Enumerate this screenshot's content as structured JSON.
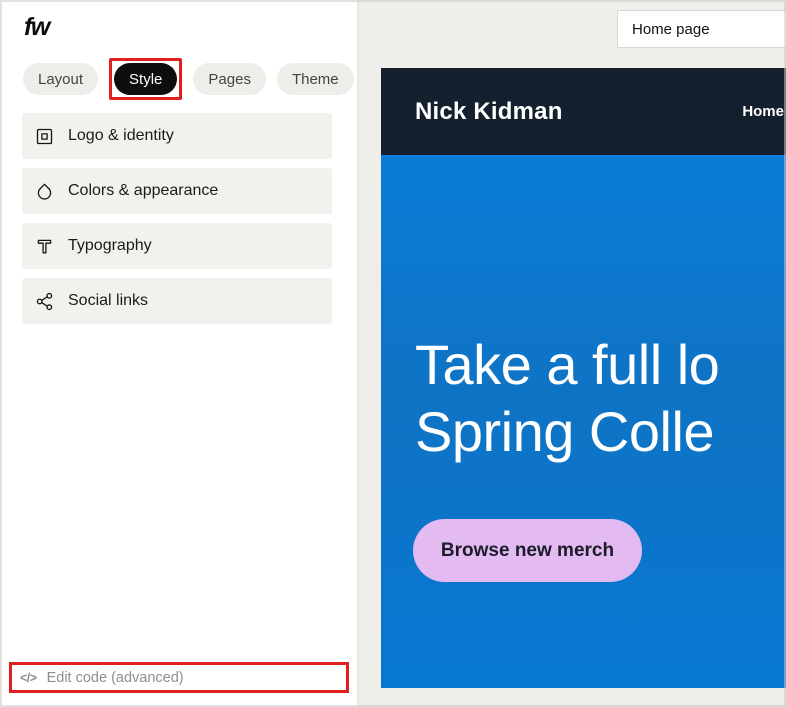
{
  "app": {
    "logo": "fw"
  },
  "colors": {
    "annotation_red": "#e01f1f",
    "panel_bg": "#ffffff",
    "canvas_bg": "#f0eeeb",
    "pill_bg": "#efedea",
    "pill_active_bg": "#0e0e0e",
    "item_bg": "#f2f1ee",
    "site_header_bg": "#15202e",
    "hero_blue_top": "#0a7bd6",
    "hero_blue_bottom": "#0877d2",
    "cta_bg": "#e3bbf2",
    "cta_text": "#1c1b29",
    "muted_text": "#8f8e8a"
  },
  "sidebar": {
    "tabs": [
      {
        "label": "Layout",
        "active": false
      },
      {
        "label": "Style",
        "active": true,
        "annotated": true
      },
      {
        "label": "Pages",
        "active": false
      },
      {
        "label": "Theme",
        "active": false
      }
    ],
    "items": [
      {
        "icon": "logo-identity-icon",
        "label": "Logo & identity"
      },
      {
        "icon": "droplet-icon",
        "label": "Colors & appearance"
      },
      {
        "icon": "typography-icon",
        "label": "Typography"
      },
      {
        "icon": "share-icon",
        "label": "Social links"
      }
    ],
    "edit_code": {
      "icon": "code-icon",
      "icon_glyph": "</>",
      "label": "Edit code (advanced)",
      "annotated": true
    }
  },
  "preview": {
    "page_selector": "Home page",
    "site": {
      "brand": "Nick Kidman",
      "nav": [
        "Home"
      ],
      "hero_line1": "Take a full lo",
      "hero_line2": "Spring Colle",
      "cta": "Browse new merch"
    }
  }
}
